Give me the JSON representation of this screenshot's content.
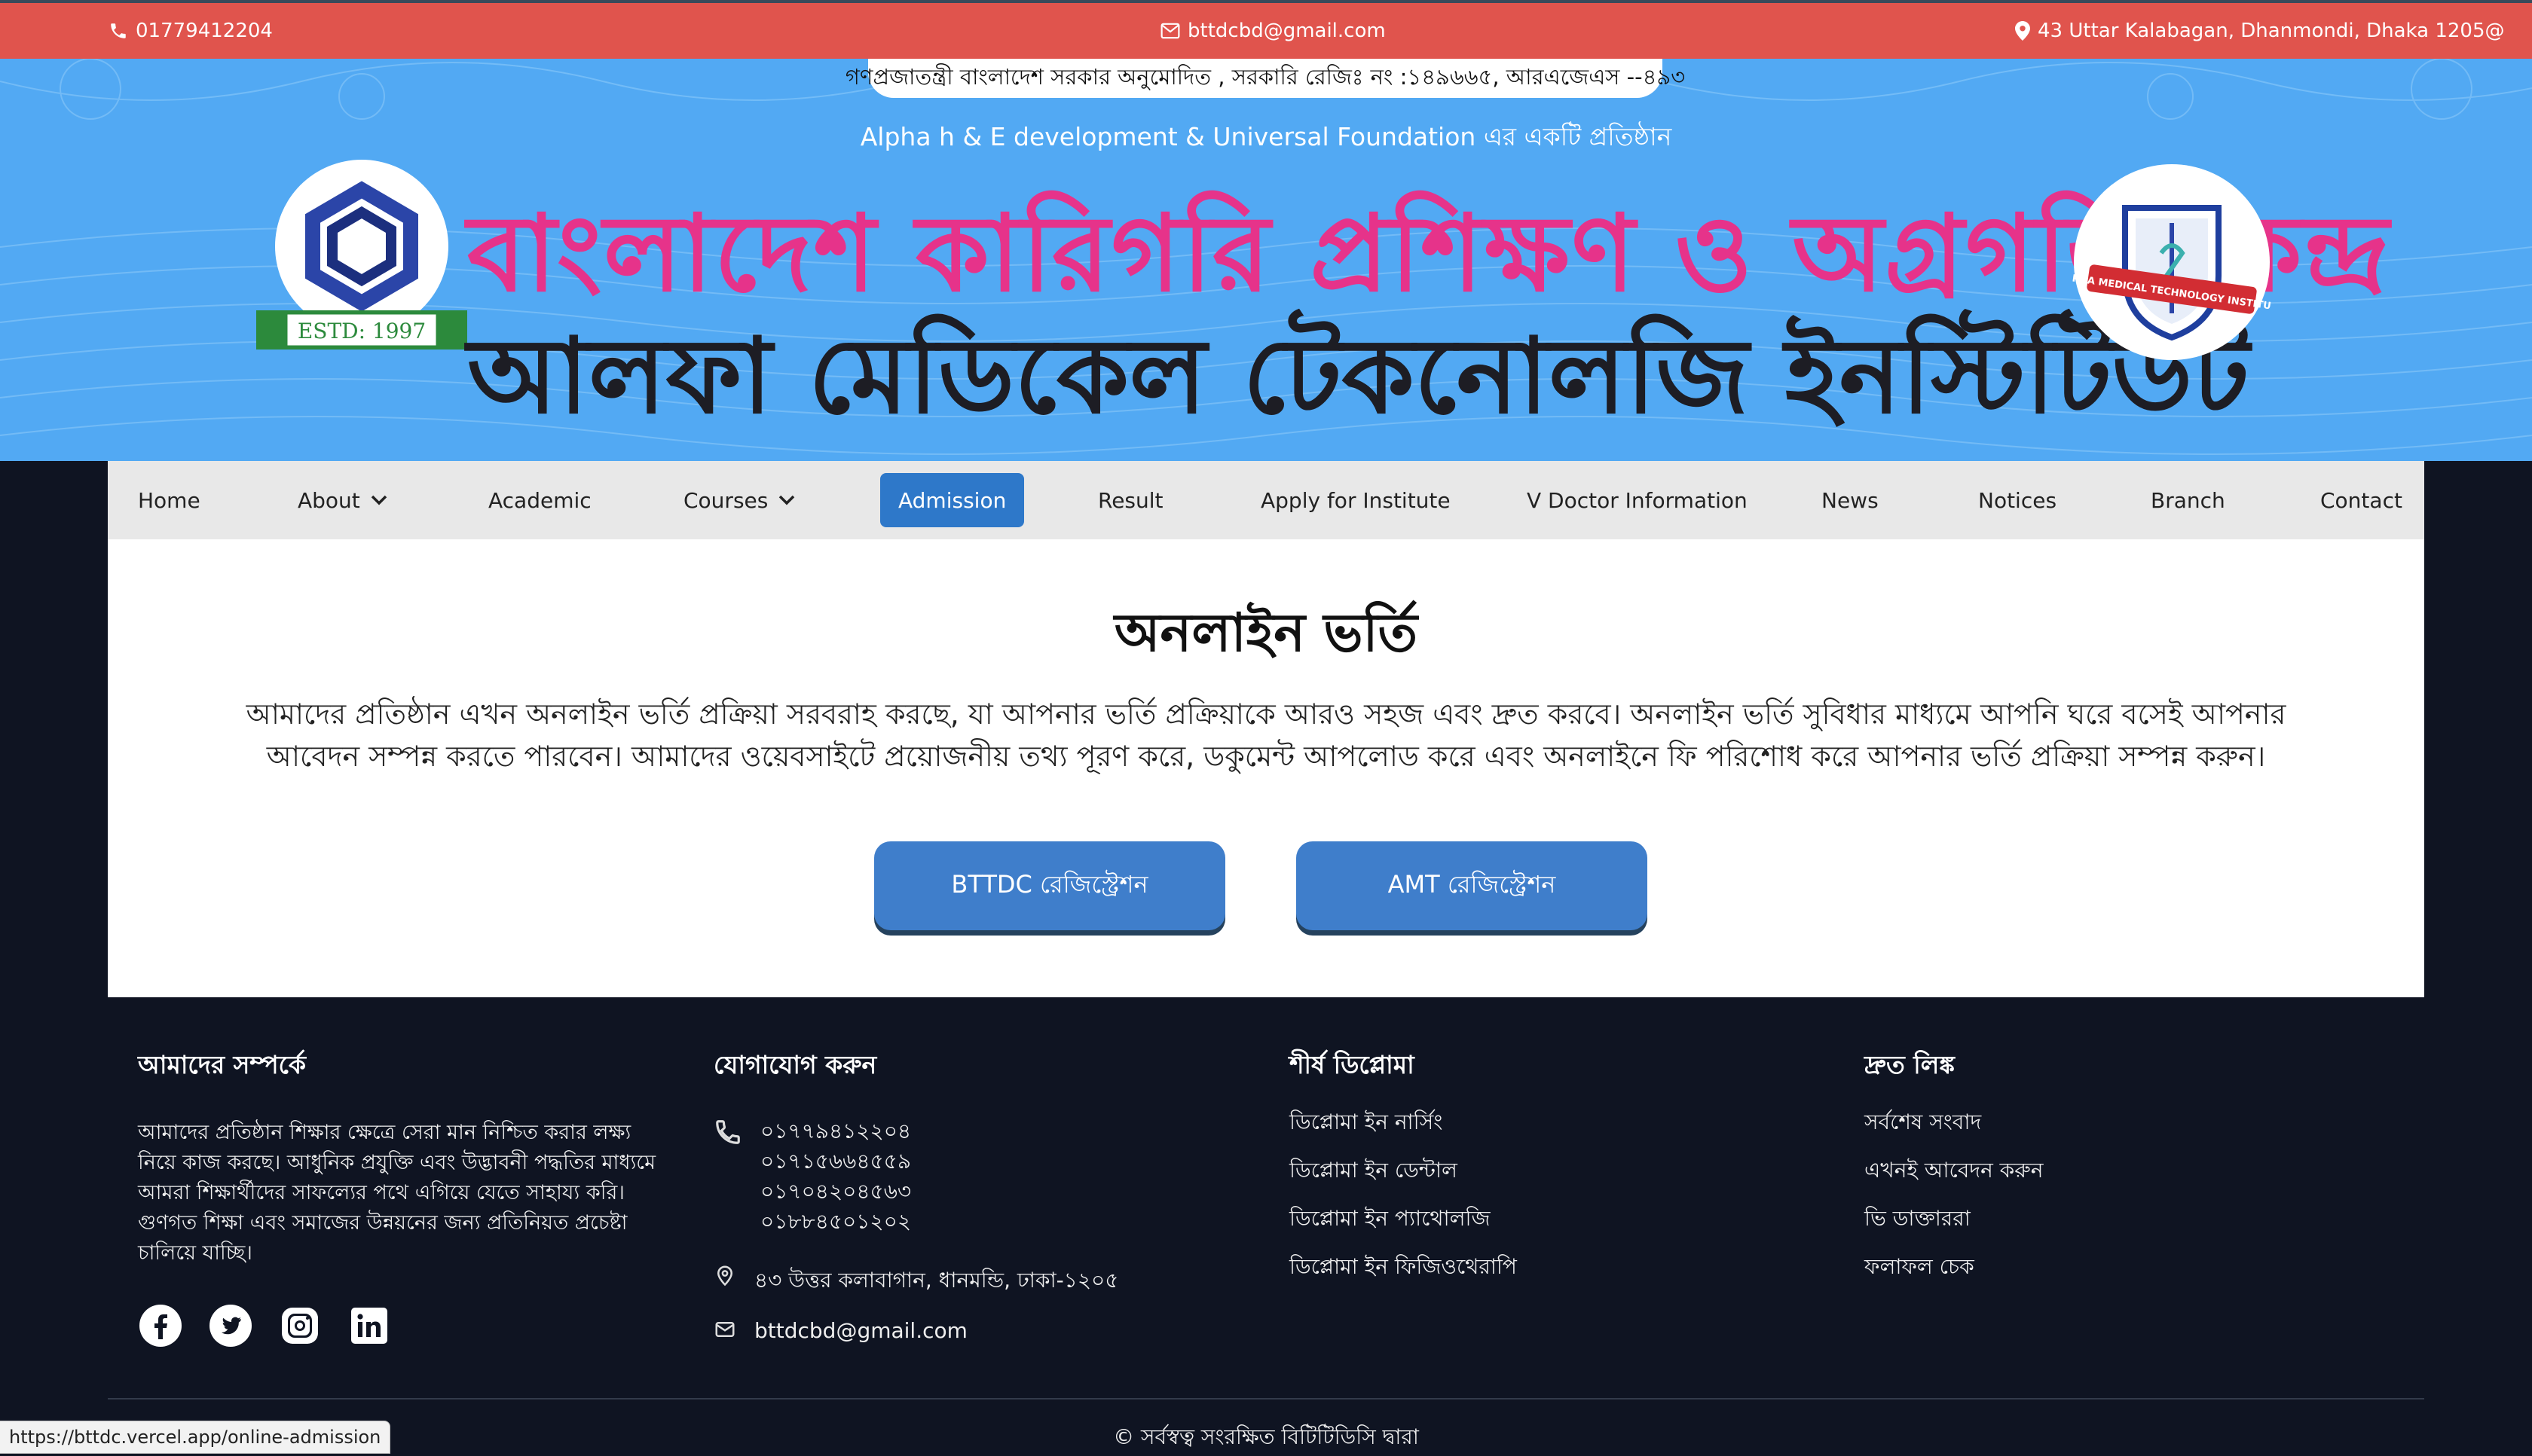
{
  "topbar": {
    "phone": "01779412204",
    "email": "bttdcbd@gmail.com",
    "address": "43 Uttar Kalabagan, Dhanmondi, Dhaka 1205@"
  },
  "header": {
    "govt_notice": "গণপ্রজাতন্ত্রী বাংলাদেশ সরকার অনুমোদিত , সরকারি রেজিঃ নং :১৪৯৬৬৫, আরএজেএস --৪৯৩",
    "subtitle": "Alpha h & E development & Universal Foundation এর একটি প্রতিষ্ঠান",
    "title_bn": "বাংলাদেশ কারিগরি প্রশিক্ষণ ও অগ্রগতি কেন্দ্র",
    "title_alpha": "আলফা মেডিকেল টেকনোলজি ইনস্টিটিউট",
    "logo_left_text": "ESTD: 1997",
    "logo_right_text": "ALPHA MEDICAL TECHNOLOGY INSTITUTE"
  },
  "nav": {
    "items": [
      "Home",
      "About",
      "Academic",
      "Courses",
      "Admission",
      "Result",
      "Apply for Institute",
      "V Doctor Information",
      "News",
      "Notices",
      "Branch",
      "Contact"
    ],
    "active": "Admission"
  },
  "main": {
    "title": "অনলাইন ভর্তি",
    "intro": "আমাদের প্রতিষ্ঠান এখন অনলাইন ভর্তি প্রক্রিয়া সরবরাহ করছে, যা আপনার ভর্তি প্রক্রিয়াকে আরও সহজ এবং দ্রুত করবে। অনলাইন ভর্তি সুবিধার মাধ্যমে আপনি ঘরে বসেই আপনার আবেদন সম্পন্ন করতে পারবেন। আমাদের ওয়েবসাইটে প্রয়োজনীয় তথ্য পূরণ করে, ডকুমেন্ট আপলোড করে এবং অনলাইনে ফি পরিশোধ করে আপনার ভর্তি প্রক্রিয়া সম্পন্ন করুন।",
    "btn_bttdc": "BTTDC রেজিস্ট্রেশন",
    "btn_amt": "AMT রেজিস্ট্রেশন"
  },
  "footer": {
    "about_title": "আমাদের সম্পর্কে",
    "about_text": "আমাদের প্রতিষ্ঠান শিক্ষার ক্ষেত্রে সেরা মান নিশ্চিত করার লক্ষ্য নিয়ে কাজ করছে। আধুনিক প্রযুক্তি এবং উদ্ভাবনী পদ্ধতির মাধ্যমে আমরা শিক্ষার্থীদের সাফল্যের পথে এগিয়ে যেতে সাহায্য করি। গুণগত শিক্ষা এবং সমাজের উন্নয়নের জন্য প্রতিনিয়ত প্রচেষ্টা চালিয়ে যাচ্ছি।",
    "contact_title": "যোগাযোগ করুন",
    "phones": [
      "০১৭৭৯৪১২২০৪",
      "০১৭১৫৬৬৪৫৫৯",
      "০১৭০৪২০৪৫৬৩",
      "০১৮৮৪৫০১২০২"
    ],
    "address": "৪৩ উত্তর কলাবাগান, ধানমন্ডি, ঢাকা-১২০৫",
    "email": "bttdcbd@gmail.com",
    "diploma_title": "শীর্ষ ডিপ্লোমা",
    "diplomas": [
      "ডিপ্লোমা ইন নার্সিং",
      "ডিপ্লোমা ইন ডেন্টাল",
      "ডিপ্লোমা ইন প্যাথোলজি",
      "ডিপ্লোমা ইন ফিজিওথেরাপি"
    ],
    "quick_title": "দ্রুত লিঙ্ক",
    "quick_links": [
      "সর্বশেষ সংবাদ",
      "এখনই আবেদন করুন",
      "ভি ডাক্তাররা",
      "ফলাফল চেক"
    ],
    "copyright": "© সর্বস্বত্ব সংরক্ষিত বিটিটিডিসি দ্বারা"
  },
  "status_bar": {
    "url": "https://bttdc.vercel.app/online-admission"
  },
  "colors": {
    "topbar": "#e0544d",
    "banner": "#52a9f3",
    "title_pink": "#e6338a",
    "nav_active": "#2e78c9",
    "button": "#3f7ecb",
    "footer": "#0f1422"
  }
}
